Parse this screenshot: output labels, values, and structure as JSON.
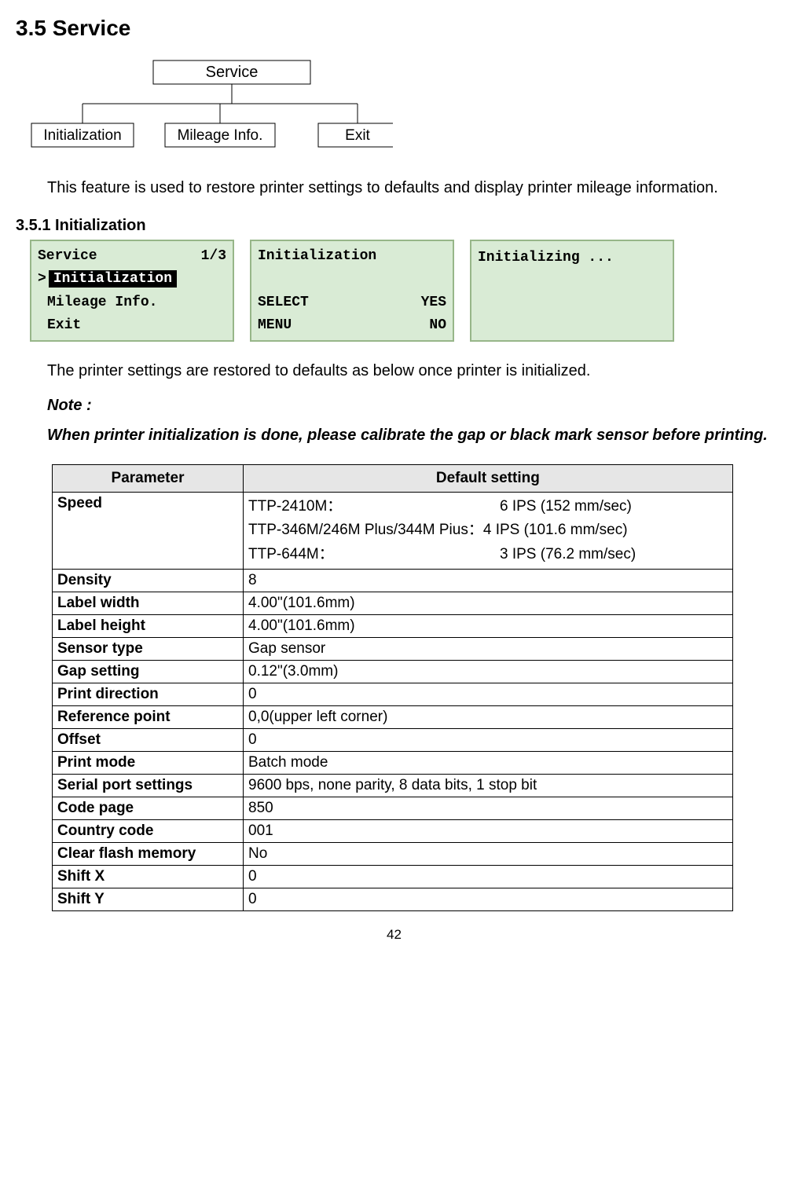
{
  "section": {
    "title": "3.5 Service",
    "diagram": {
      "root": "Service",
      "children": [
        "Initialization",
        "Mileage Info.",
        "Exit"
      ]
    },
    "intro": "This feature is used to restore printer settings to defaults and display printer mileage information.",
    "subTitle": "3.5.1 Initialization",
    "screens": {
      "screen1": {
        "title_left": "Service",
        "title_right": "1/3",
        "cursor": ">",
        "item1": "Initialization",
        "item2": "Mileage Info.",
        "item3": "Exit"
      },
      "screen2": {
        "title": "Initialization",
        "line1_left": "SELECT",
        "line1_right": "YES",
        "line2_left": "MENU",
        "line2_right": "NO"
      },
      "screen3": {
        "title": "Initializing ..."
      }
    },
    "afterScreens": "The printer settings are restored to defaults as below once printer is initialized.",
    "noteLabel": "Note :",
    "noteText": "When printer initialization is done, please calibrate the gap or black mark sensor before printing.",
    "tableHeaders": {
      "c1": "Parameter",
      "c2": "Default setting"
    },
    "rows": {
      "speed": {
        "param": "Speed",
        "l1m": "TTP-2410M：",
        "l1v": "6 IPS (152 mm/sec)",
        "l2m": "TTP-346M/246M Plus/344M Pius：",
        "l2v": "4 IPS (101.6 mm/sec)",
        "l3m": "TTP-644M：",
        "l3v": "3 IPS (76.2 mm/sec)"
      },
      "density": {
        "param": "Density",
        "val": "8"
      },
      "labelWidth": {
        "param": "Label width",
        "val": "4.00\"(101.6mm)"
      },
      "labelHeight": {
        "param": "Label height",
        "val": "4.00\"(101.6mm)"
      },
      "sensorType": {
        "param": "Sensor type",
        "val": "Gap sensor"
      },
      "gapSetting": {
        "param": "Gap setting",
        "val": "0.12\"(3.0mm)"
      },
      "printDirection": {
        "param": "Print direction",
        "val": "0"
      },
      "referencePoint": {
        "param": "Reference point",
        "val": "0,0(upper left corner)"
      },
      "offset": {
        "param": "Offset",
        "val": "0"
      },
      "printMode": {
        "param": "Print mode",
        "val": "Batch mode"
      },
      "serial": {
        "param": "Serial port settings",
        "val": "9600 bps, none parity, 8 data bits, 1 stop bit"
      },
      "codePage": {
        "param": "Code page",
        "val": "850"
      },
      "countryCode": {
        "param": "Country code",
        "val": "001"
      },
      "clearFlash": {
        "param": "Clear flash memory",
        "val": "No"
      },
      "shiftX": {
        "param": "Shift X",
        "val": "0"
      },
      "shiftY": {
        "param": "Shift Y",
        "val": "0"
      }
    }
  },
  "pageNumber": "42"
}
